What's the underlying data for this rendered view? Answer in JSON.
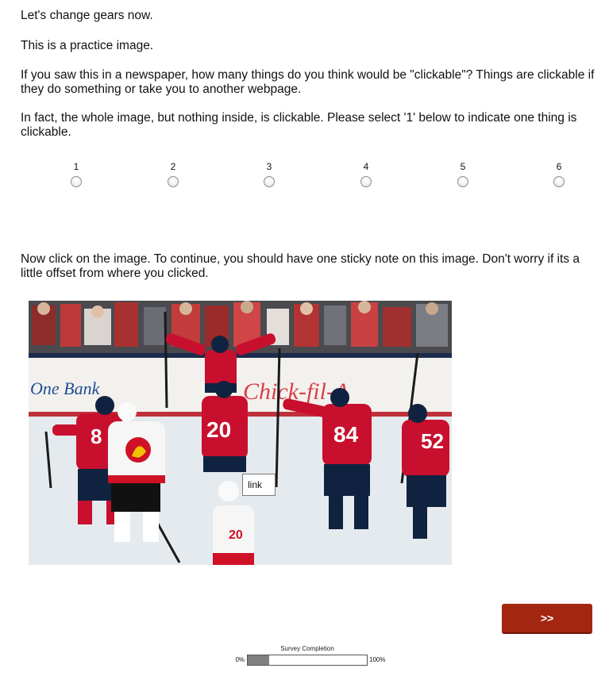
{
  "intro": {
    "line1": "Let's change gears now.",
    "line2": "This is a practice image.",
    "line3": "If you saw this in a newspaper, how many things do you think would be \"clickable\"? Things are clickable if they do something or take you to another webpage.",
    "line4": "In fact, the whole image, but nothing inside, is clickable. Please select '1' below to indicate one thing is clickable."
  },
  "choices": [
    "1",
    "2",
    "3",
    "4",
    "5",
    "6"
  ],
  "instruction": "Now click on the image. To continue, you should have one sticky note on this image. Don't worry if its a little offset from where you clicked.",
  "photo": {
    "sponsor_left": "One Bank",
    "sponsor_right": "Chick-fil-A",
    "jersey_numbers": [
      "8",
      "20",
      "84",
      "52",
      "20"
    ],
    "sticky_label": "link"
  },
  "nav": {
    "next_label": ">>"
  },
  "progress": {
    "title": "Survey Completion",
    "min_label": "0%",
    "max_label": "100%",
    "value_fraction": 0.18
  },
  "colors": {
    "accent": "#a32710",
    "caps_red": "#c8102e",
    "caps_navy": "#0f2340",
    "flames_red": "#ce1126"
  }
}
